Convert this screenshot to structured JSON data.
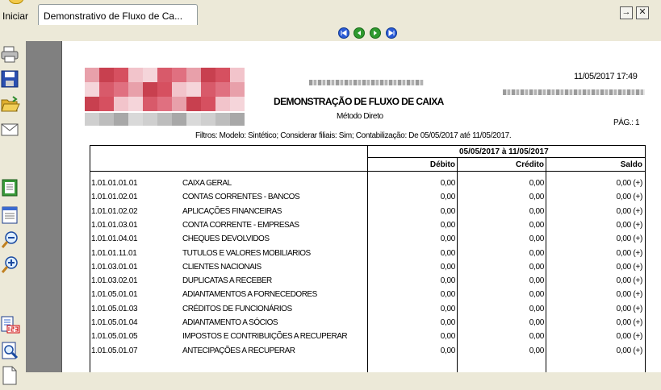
{
  "taskbar": {
    "start_label": "Iniciar",
    "tab_title": "Demonstrativo de Fluxo de Ca...",
    "btn_forward": "→",
    "btn_close": "✕"
  },
  "report": {
    "title": "DEMONSTRAÇÃO DE FLUXO DE CAIXA",
    "subtitle": "Método Direto",
    "datetime": "11/05/2017 17:49",
    "page_label": "PÁG.: 1",
    "filters": "Filtros: Modelo: Sintético; Considerar filiais: Sim; Contabilização: De 05/05/2017 até 11/05/2017.",
    "period": "05/05/2017 à 11/05/2017",
    "col_debit": "Débito",
    "col_credit": "Crédito",
    "col_balance": "Saldo"
  },
  "rows": [
    {
      "account": "1.01.01.01.01",
      "description": "CAIXA GERAL",
      "debit": "0,00",
      "credit": "0,00",
      "balance": "0,00 (+)"
    },
    {
      "account": "1.01.01.02.01",
      "description": "CONTAS CORRENTES - BANCOS",
      "debit": "0,00",
      "credit": "0,00",
      "balance": "0,00 (+)"
    },
    {
      "account": "1.01.01.02.02",
      "description": "APLICAÇÕES FINANCEIRAS",
      "debit": "0,00",
      "credit": "0,00",
      "balance": "0,00 (+)"
    },
    {
      "account": "1.01.01.03.01",
      "description": "CONTA CORRENTE - EMPRESAS",
      "debit": "0,00",
      "credit": "0,00",
      "balance": "0,00 (+)"
    },
    {
      "account": "1.01.01.04.01",
      "description": "CHEQUES DEVOLVIDOS",
      "debit": "0,00",
      "credit": "0,00",
      "balance": "0,00 (+)"
    },
    {
      "account": "1.01.01.11.01",
      "description": "TUTULOS E VALORES MOBILIARIOS",
      "debit": "0,00",
      "credit": "0,00",
      "balance": "0,00 (+)"
    },
    {
      "account": "1.01.03.01.01",
      "description": "CLIENTES NACIONAIS",
      "debit": "0,00",
      "credit": "0,00",
      "balance": "0,00 (+)"
    },
    {
      "account": "1.01.03.02.01",
      "description": "DUPLICATAS A RECEBER",
      "debit": "0,00",
      "credit": "0,00",
      "balance": "0,00 (+)"
    },
    {
      "account": "1.01.05.01.01",
      "description": "ADIANTAMENTOS A FORNECEDORES",
      "debit": "0,00",
      "credit": "0,00",
      "balance": "0,00 (+)"
    },
    {
      "account": "1.01.05.01.03",
      "description": "CRÉDITOS DE FUNCIONÁRIOS",
      "debit": "0,00",
      "credit": "0,00",
      "balance": "0,00 (+)"
    },
    {
      "account": "1.01.05.01.04",
      "description": "ADIANTAMENTO A SÓCIOS",
      "debit": "0,00",
      "credit": "0,00",
      "balance": "0,00 (+)"
    },
    {
      "account": "1.01.05.01.05",
      "description": "IMPOSTOS E CONTRIBUIÇÕES A RECUPERAR",
      "debit": "0,00",
      "credit": "0,00",
      "balance": "0,00 (+)"
    },
    {
      "account": "1.01.05.01.07",
      "description": "ANTECIPAÇÕES A RECUPERAR",
      "debit": "0,00",
      "credit": "0,00",
      "balance": "0,00 (+)"
    }
  ]
}
